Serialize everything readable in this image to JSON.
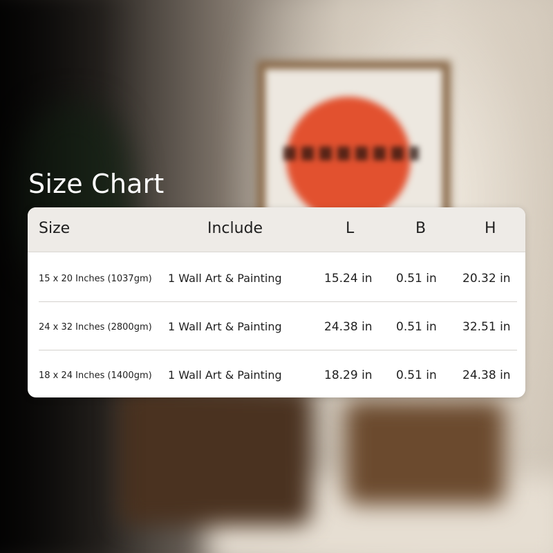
{
  "title": "Size Chart",
  "table": {
    "headers": [
      "Size",
      "Include",
      "L",
      "B",
      "H"
    ],
    "rows": [
      {
        "size": "15 x 20 Inches (1037gm)",
        "include": "1 Wall Art & Painting",
        "l": "15.24 in",
        "b": "0.51 in",
        "h": "20.32 in"
      },
      {
        "size": "24 x 32 Inches (2800gm)",
        "include": "1 Wall Art & Painting",
        "l": "24.38 in",
        "b": "0.51 in",
        "h": "32.51 in"
      },
      {
        "size": "18 x 24 Inches (1400gm)",
        "include": "1 Wall Art & Painting",
        "l": "18.29 in",
        "b": "0.51 in",
        "h": "24.38 in"
      }
    ]
  },
  "colors": {
    "header_bg": "#eeebe7",
    "card_bg": "#ffffff",
    "title_text": "#ffffff",
    "body_text": "#1f1f1f"
  }
}
